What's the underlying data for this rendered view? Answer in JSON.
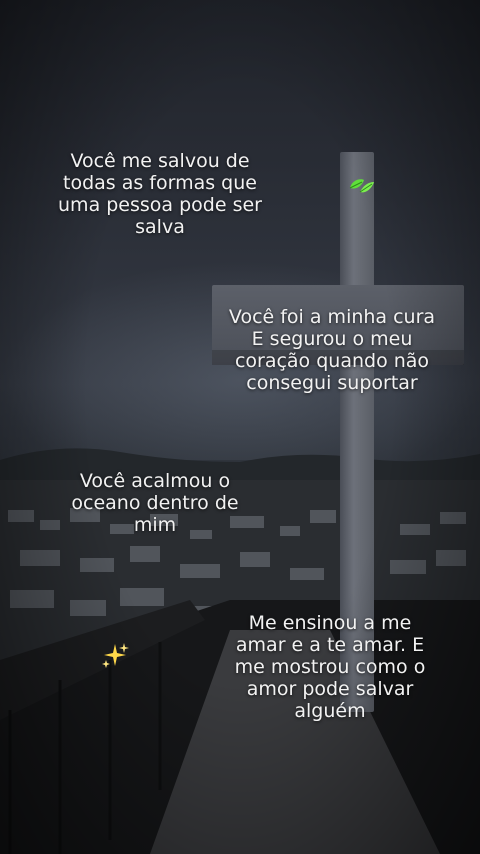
{
  "captions": {
    "first": "Você me salvou de\ntodas as formas que\numa pessoa pode ser\nsalva",
    "second": "Você foi a minha cura\nE segurou o meu\ncoração quando não\nconsegui suportar",
    "third": "Você acalmou o\noceano dentro de\nmim",
    "fourth": "Me ensinou a me\namar e a te amar. E\nme mostrou como o\namor pode salvar\nalguém"
  },
  "icons": {
    "leaf": "leaf-icon",
    "sparkles": "sparkles-icon"
  },
  "colors": {
    "text": "#f2f2f2",
    "leaf": "#5fe03a",
    "sparkle": "#ffd84a"
  }
}
